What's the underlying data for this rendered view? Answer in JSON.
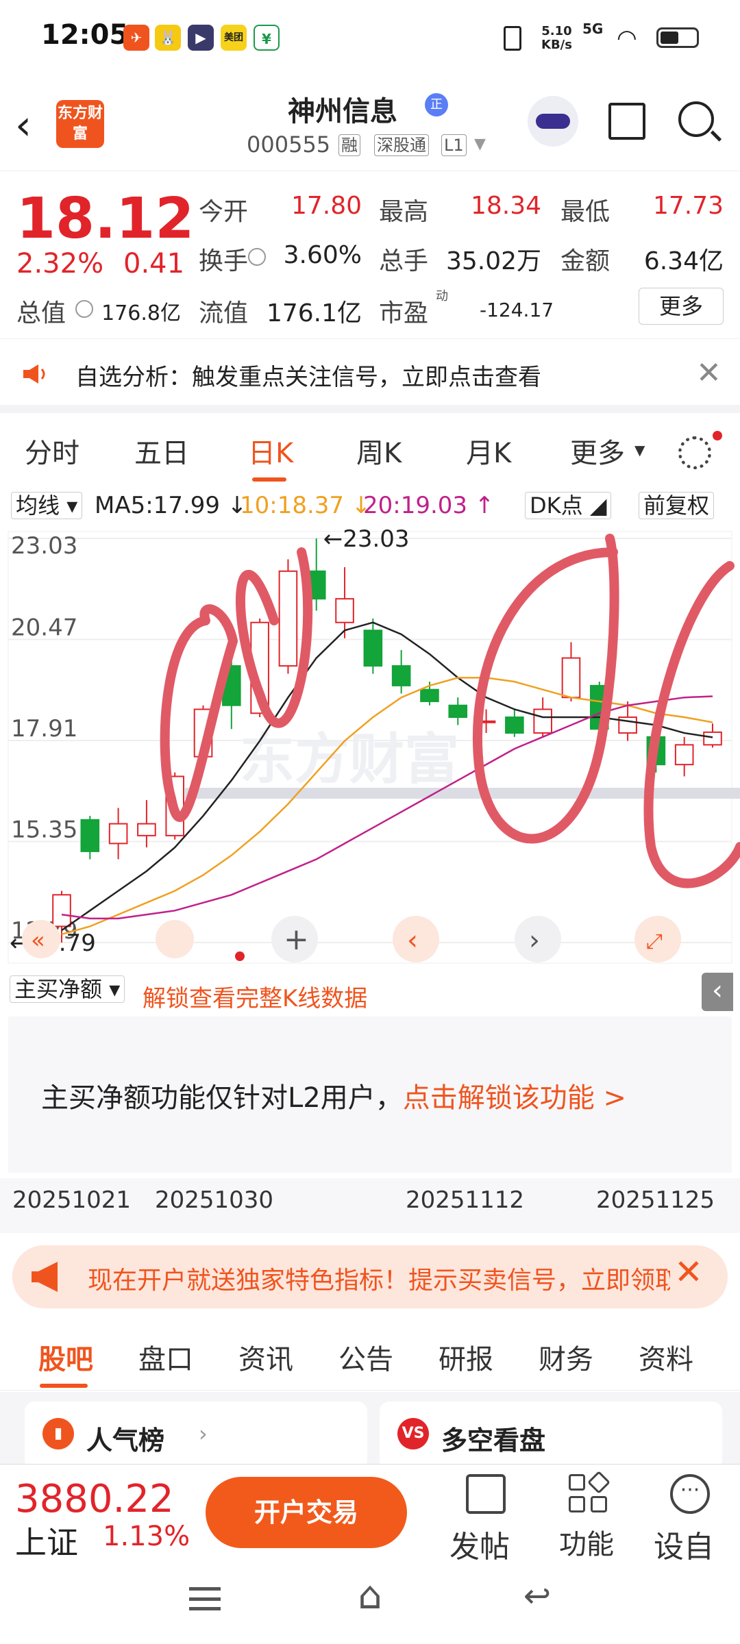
{
  "status": {
    "time": "12:05",
    "net_speed": "5.10",
    "net_unit": "KB/s",
    "signal": "5G"
  },
  "header": {
    "logo_text": "东方财富",
    "title": "神州信息",
    "badge": "正",
    "code": "000555",
    "tags": [
      "融",
      "深股通",
      "L1"
    ]
  },
  "quote": {
    "price": "18.12",
    "change_pct": "2.32%",
    "change": "0.41",
    "items": [
      {
        "label": "今开",
        "value": "17.80"
      },
      {
        "label": "最高",
        "value": "18.34"
      },
      {
        "label": "最低",
        "value": "17.73"
      },
      {
        "label": "换手",
        "value": "3.60%"
      },
      {
        "label": "总手",
        "value": "35.02万"
      },
      {
        "label": "金额",
        "value": "6.34亿"
      },
      {
        "label": "总值",
        "value": "176.8亿"
      },
      {
        "label": "流值",
        "value": "176.1亿"
      },
      {
        "label": "市盈",
        "value": "-124.17"
      }
    ],
    "pe_sup": "动",
    "more": "更多"
  },
  "notice": {
    "text": "自选分析：触发重点关注信号，立即点击查看"
  },
  "tabs": [
    "分时",
    "五日",
    "日K",
    "周K",
    "月K",
    "更多"
  ],
  "ma_bar": {
    "selector": "均线",
    "ma5": "MA5:17.99 ↓",
    "ma10": "10:18.37 ↓",
    "ma20": "20:19.03 ↑",
    "dk": "DK点",
    "adj": "前复权"
  },
  "chart_data": {
    "type": "candlestick",
    "y_ticks": [
      "23.03",
      "20.47",
      "17.91",
      "15.35",
      "12.79"
    ],
    "max_label": "←23.03",
    "min_label": "←12.79",
    "ylim": [
      12.79,
      23.03
    ],
    "candles": [
      {
        "o": 13.2,
        "c": 14.0,
        "h": 14.1,
        "l": 12.79
      },
      {
        "o": 15.9,
        "c": 15.1,
        "h": 16.0,
        "l": 14.9
      },
      {
        "o": 15.3,
        "c": 15.8,
        "h": 16.2,
        "l": 14.9
      },
      {
        "o": 15.5,
        "c": 15.8,
        "h": 16.4,
        "l": 15.2
      },
      {
        "o": 15.5,
        "c": 17.0,
        "h": 17.1,
        "l": 15.4
      },
      {
        "o": 17.5,
        "c": 18.7,
        "h": 18.8,
        "l": 17.4
      },
      {
        "o": 19.8,
        "c": 18.8,
        "h": 20.0,
        "l": 18.2
      },
      {
        "o": 18.6,
        "c": 20.9,
        "h": 21.0,
        "l": 18.5
      },
      {
        "o": 19.8,
        "c": 22.2,
        "h": 22.5,
        "l": 19.6
      },
      {
        "o": 22.2,
        "c": 21.5,
        "h": 23.03,
        "l": 21.2
      },
      {
        "o": 20.9,
        "c": 21.5,
        "h": 22.3,
        "l": 20.5
      },
      {
        "o": 20.7,
        "c": 19.8,
        "h": 21.0,
        "l": 19.6
      },
      {
        "o": 19.8,
        "c": 19.3,
        "h": 20.2,
        "l": 19.1
      },
      {
        "o": 19.2,
        "c": 18.9,
        "h": 19.4,
        "l": 18.8
      },
      {
        "o": 18.8,
        "c": 18.5,
        "h": 19.0,
        "l": 18.3
      },
      {
        "o": 18.4,
        "c": 18.4,
        "h": 18.7,
        "l": 18.1
      },
      {
        "o": 18.5,
        "c": 18.1,
        "h": 18.7,
        "l": 18.0
      },
      {
        "o": 18.1,
        "c": 18.7,
        "h": 19.0,
        "l": 18.0
      },
      {
        "o": 19.0,
        "c": 20.0,
        "h": 20.4,
        "l": 18.9
      },
      {
        "o": 19.3,
        "c": 18.2,
        "h": 19.4,
        "l": 18.0
      },
      {
        "o": 18.1,
        "c": 18.5,
        "h": 18.9,
        "l": 17.9
      },
      {
        "o": 18.0,
        "c": 17.3,
        "h": 18.1,
        "l": 17.1
      },
      {
        "o": 17.3,
        "c": 17.8,
        "h": 18.0,
        "l": 17.0
      },
      {
        "o": 17.8,
        "c": 18.12,
        "h": 18.34,
        "l": 17.73
      }
    ],
    "ma5": [
      13.1,
      13.6,
      14.1,
      14.6,
      15.2,
      16.0,
      16.9,
      17.9,
      19.0,
      20.0,
      20.7,
      20.9,
      20.6,
      20.1,
      19.5,
      19.0,
      18.7,
      18.5,
      18.5,
      18.5,
      18.4,
      18.3,
      18.1,
      17.99
    ],
    "ma10": [
      13.0,
      13.2,
      13.5,
      13.8,
      14.1,
      14.5,
      15.0,
      15.6,
      16.3,
      17.1,
      17.9,
      18.5,
      19.0,
      19.3,
      19.5,
      19.5,
      19.4,
      19.2,
      19.0,
      18.9,
      18.8,
      18.6,
      18.5,
      18.37
    ],
    "ma20": [
      13.5,
      13.4,
      13.4,
      13.5,
      13.6,
      13.8,
      14.0,
      14.3,
      14.6,
      14.9,
      15.3,
      15.7,
      16.1,
      16.5,
      16.9,
      17.3,
      17.7,
      18.0,
      18.3,
      18.6,
      18.8,
      18.9,
      19.0,
      19.03
    ],
    "watermark": "东方财富"
  },
  "lower": {
    "selector": "主买净额",
    "unlock_link": "解锁查看完整K线数据",
    "message": "主买净额功能仅针对L2用户，",
    "message_link": "点击解锁该功能 >"
  },
  "dates": [
    "20251021",
    "20251030",
    "20251112",
    "20251125"
  ],
  "promo": {
    "text": "现在开户就送独家特色指标！提示买卖信号，立即领取"
  },
  "bottom_tabs": [
    "股吧",
    "盘口",
    "资讯",
    "公告",
    "研报",
    "财务",
    "资料"
  ],
  "cards": [
    {
      "title": "人气榜",
      "icon": "rank-icon"
    },
    {
      "title": "多空看盘",
      "icon": "vs-icon"
    }
  ],
  "bottom_bar": {
    "index_value": "3880.22",
    "index_name": "上证",
    "index_pct": "1.13%",
    "trade": "开户交易",
    "post": "发帖",
    "func": "功能",
    "custom": "设自"
  },
  "colors": {
    "up": "#e1242a",
    "down": "#13a43a",
    "accent": "#f0541e",
    "ma5": "#222222",
    "ma10": "#f0a020",
    "ma20": "#c0208a",
    "annotation": "#e05a66"
  }
}
